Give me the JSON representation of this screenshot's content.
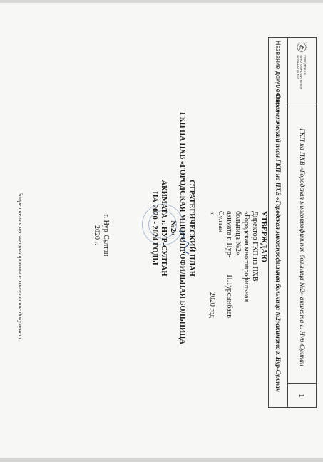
{
  "header": {
    "title": "ГКП на ПХВ «Городская многопрофильная больница №2» акимата г. Нур-Султан",
    "page_number": "1",
    "doc_name_label": "Название документа:",
    "doc_name_value": "Стратегический план ГКП на ПХВ «Городская многопрофильная больница №2»акимата г. Нур-Султан",
    "logo_text": "ГОРОДСКАЯ МНОГОПРОФИЛЬНАЯ БОЛЬНИЦА №2"
  },
  "approval": {
    "title": "УТВЕРЖДАЮ",
    "lines": [
      "Директор ГКП на ПХВ",
      "«Городская многопрофильная",
      "больница №2»",
      "акимата г. Нур-Султан"
    ],
    "signatory": "Н.Турсынбаев",
    "date_prefix": "«",
    "date_suffix": "2020 год"
  },
  "main_title": {
    "lines": [
      "СТРАТЕГИЧЕСКИЙ ПЛАН",
      "ГКП НА ПХВ «ГОРОДСКАЯ МНОГОПРОФИЛЬНАЯ БОЛЬНИЦА №2»",
      "АКИМАТА г. НУР-СУЛТАН",
      "НА 2020 - 2024 ГОДЫ"
    ]
  },
  "place": {
    "city": "г. Нур-Султан",
    "year": "2020 г."
  },
  "footnote": "Запрещается несанкционированное копирование документа"
}
